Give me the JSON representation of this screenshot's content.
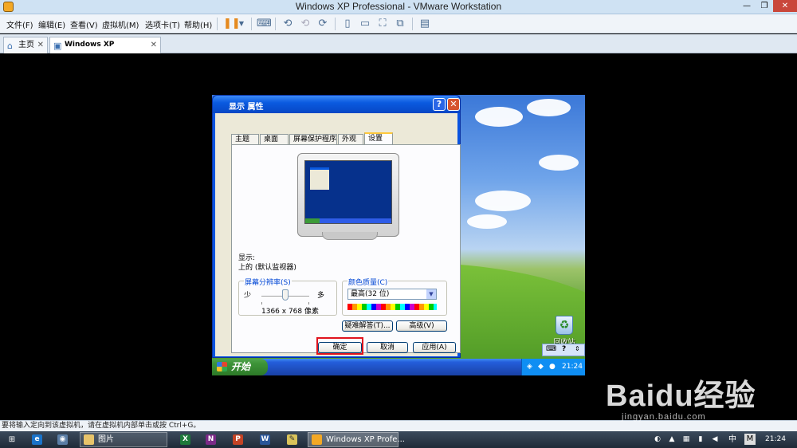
{
  "window": {
    "title": "Windows XP Professional - VMware Workstation"
  },
  "menu": [
    "文件(F)",
    "编辑(E)",
    "查看(V)",
    "虚拟机(M)",
    "选项卡(T)",
    "帮助(H)"
  ],
  "tabs": [
    {
      "label": "主页"
    },
    {
      "label": "Windows XP Professional"
    }
  ],
  "dialog": {
    "title": "显示 属性",
    "tabs": [
      "主题",
      "桌面",
      "屏幕保护程序",
      "外观",
      "设置"
    ],
    "display_label": "显示:",
    "display_value": "上的 (默认监视器)",
    "resolution": {
      "title": "屏幕分辨率(S)",
      "less": "少",
      "more": "多",
      "value": "1366 x 768 像素"
    },
    "color": {
      "title": "颜色质量(C)",
      "selected": "最高(32 位)"
    },
    "troubleshoot": "疑难解答(T)...",
    "advanced": "高级(V)",
    "ok": "确定",
    "cancel": "取消",
    "apply": "应用(A)"
  },
  "guest": {
    "recycle_bin": "回收站",
    "start": "开始",
    "clock": "21:24",
    "langbar_key": "?"
  },
  "status_text": "要将输入定向到该虚拟机，请在虚拟机内部单击或按 Ctrl+G。",
  "host_taskbar": {
    "items": [
      "图片",
      "Windows XP Profe..."
    ],
    "ime": "中",
    "ime_mode": "M",
    "clock": "21:24"
  },
  "watermark": {
    "line1": "Baidu经验",
    "line2": "jingyan.baidu.com"
  }
}
